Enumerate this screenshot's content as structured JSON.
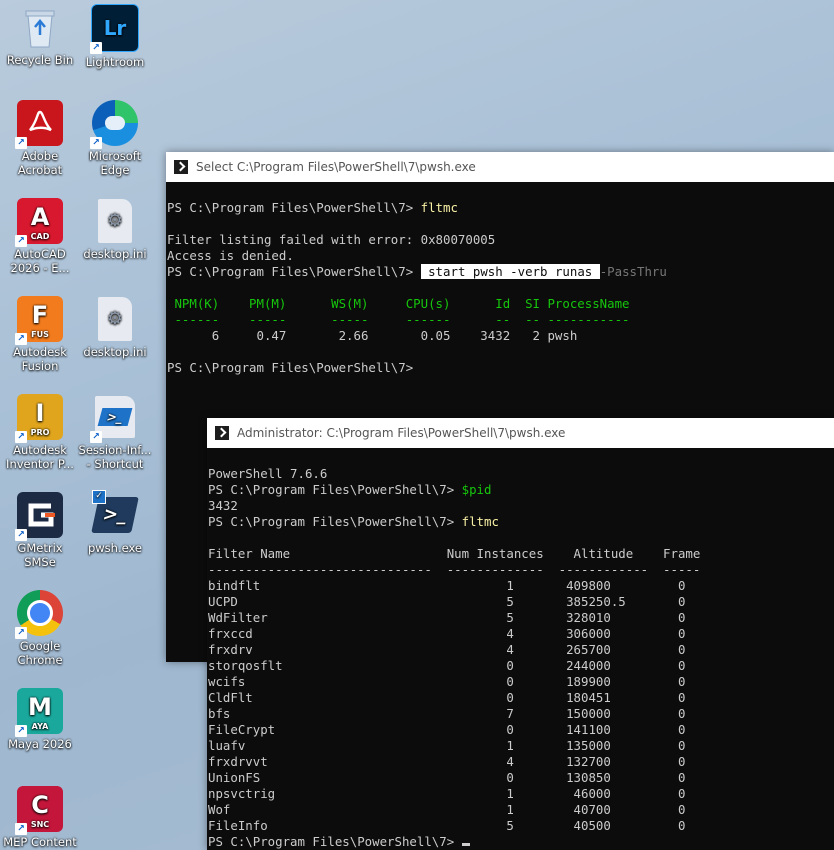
{
  "desktop_icons": [
    {
      "label": "Recycle Bin",
      "icon": "recycle-bin-icon"
    },
    {
      "label": "Lightroom",
      "icon": "lightroom-icon",
      "text": "Lr"
    },
    {
      "label": "Adobe Acrobat",
      "icon": "acrobat-icon"
    },
    {
      "label": "Microsoft Edge",
      "icon": "edge-icon"
    },
    {
      "label": "AutoCAD 2026 - E...",
      "icon": "autocad-icon",
      "text": "A",
      "sub": "CAD"
    },
    {
      "label": "desktop.ini",
      "icon": "ini-file-icon"
    },
    {
      "label": "Autodesk Fusion",
      "icon": "fusion-icon",
      "text": "F",
      "sub": "FUS"
    },
    {
      "label": "desktop.ini",
      "icon": "ini-file-icon"
    },
    {
      "label": "Autodesk Inventor P...",
      "icon": "inventor-icon",
      "text": "I",
      "sub": "PRO"
    },
    {
      "label": "Session-Inf... - Shortcut",
      "icon": "powershell-shortcut-icon"
    },
    {
      "label": "GMetrix SMSe",
      "icon": "gmetrix-icon"
    },
    {
      "label": "pwsh.exe",
      "icon": "powershell-icon"
    },
    {
      "label": "Google Chrome",
      "icon": "chrome-icon"
    },
    {
      "label": "Maya 2026",
      "icon": "maya-icon",
      "text": "M",
      "sub": "AYA"
    },
    {
      "label": "MEP Content",
      "icon": "mep-content-icon",
      "text": "C",
      "sub": "SNC"
    }
  ],
  "window1": {
    "title": "Select C:\\Program Files\\PowerShell\\7\\pwsh.exe",
    "prompt": "PS C:\\Program Files\\PowerShell\\7> ",
    "cmd1": "fltmc",
    "err1": "Filter listing failed with error: 0x80070005",
    "err2": "Access is denied.",
    "cmd2_start": " start",
    "cmd2_pwsh": " pwsh",
    "cmd2_verb": " -verb",
    "cmd2_runas": " runas ",
    "cmd2_passthru": "-PassThru",
    "table_header": " NPM(K)    PM(M)      WS(M)     CPU(s)      Id  SI ProcessName",
    "table_sep": " ------    -----      -----     ------      --  -- -----------",
    "table_row": "      6     0.47       2.66       0.05    3432   2 pwsh",
    "final_prompt": "PS C:\\Program Files\\PowerShell\\7>"
  },
  "window2": {
    "title": "Administrator: C:\\Program Files\\PowerShell\\7\\pwsh.exe",
    "version": "PowerShell 7.6.6",
    "prompt": "PS C:\\Program Files\\PowerShell\\7> ",
    "cmd1": "$pid",
    "pid_output": "3432",
    "cmd2": "fltmc",
    "header": "Filter Name                     Num Instances    Altitude    Frame",
    "separator": "------------------------------  -------------  ------------  -----",
    "rows": [
      "bindflt                                 1       409800         0",
      "UCPD                                    5       385250.5       0",
      "WdFilter                                5       328010         0",
      "frxccd                                  4       306000         0",
      "frxdrv                                  4       265700         0",
      "storqosflt                              0       244000         0",
      "wcifs                                   0       189900         0",
      "CldFlt                                  0       180451         0",
      "bfs                                     7       150000         0",
      "FileCrypt                               0       141100         0",
      "luafv                                   1       135000         0",
      "frxdrvvt                                4       132700         0",
      "UnionFS                                 0       130850         0",
      "npsvctrig                               1        46000         0",
      "Wof                                     1        40700         0",
      "FileInfo                                5        40500         0"
    ],
    "final_prompt": "PS C:\\Program Files\\PowerShell\\7> "
  }
}
